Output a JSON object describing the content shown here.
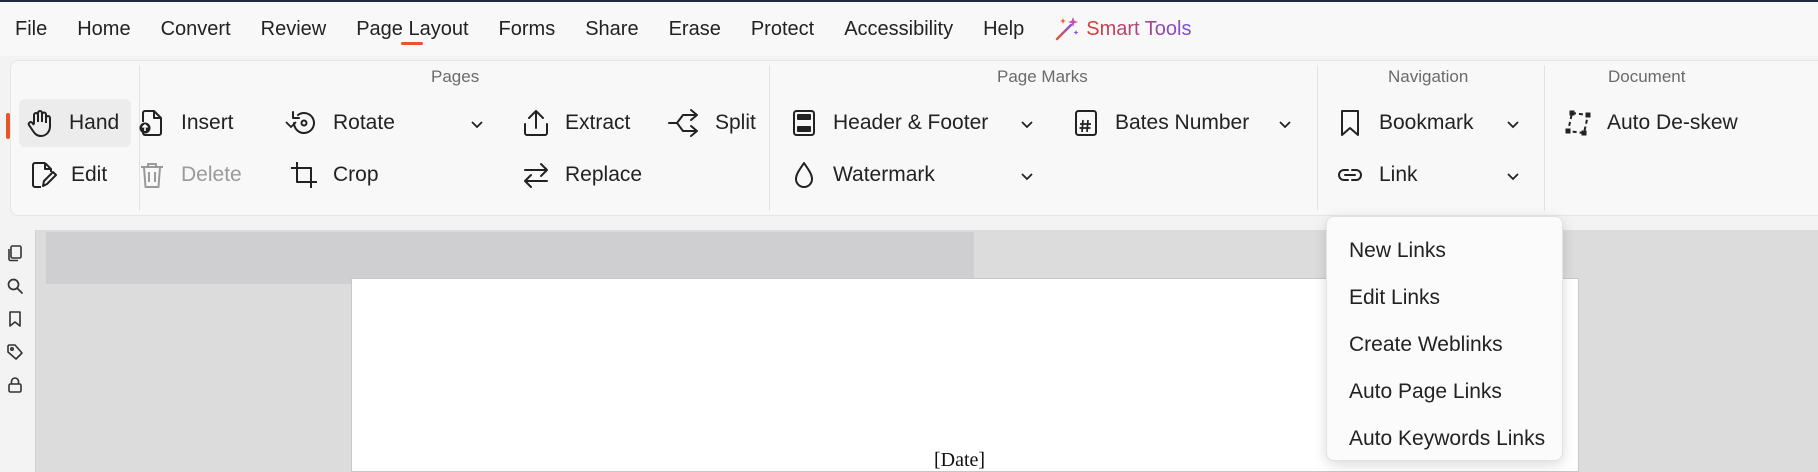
{
  "menu": {
    "items": [
      "File",
      "Home",
      "Convert",
      "Review",
      "Page Layout",
      "Forms",
      "Share",
      "Erase",
      "Protect",
      "Accessibility",
      "Help"
    ],
    "active": "Page Layout",
    "smart_tools_label": "Smart Tools"
  },
  "ribbon": {
    "groups": {
      "pages": "Pages",
      "page_marks": "Page Marks",
      "navigation": "Navigation",
      "document": "Document"
    },
    "tools": {
      "hand": "Hand",
      "edit": "Edit",
      "insert": "Insert",
      "delete": "Delete",
      "rotate": "Rotate",
      "crop": "Crop",
      "extract": "Extract",
      "replace": "Replace",
      "split": "Split",
      "header_footer": "Header & Footer",
      "watermark": "Watermark",
      "bates_number": "Bates Number",
      "bookmark": "Bookmark",
      "link": "Link",
      "auto_deskew": "Auto De-skew"
    }
  },
  "link_menu": {
    "items": [
      "New Links",
      "Edit Links",
      "Create Weblinks",
      "Auto Page Links",
      "Auto Keywords Links"
    ]
  },
  "document": {
    "visible_text": "[Date]"
  },
  "colors": {
    "accent": "#e8542a",
    "smart_tools": "#d83b2f"
  }
}
